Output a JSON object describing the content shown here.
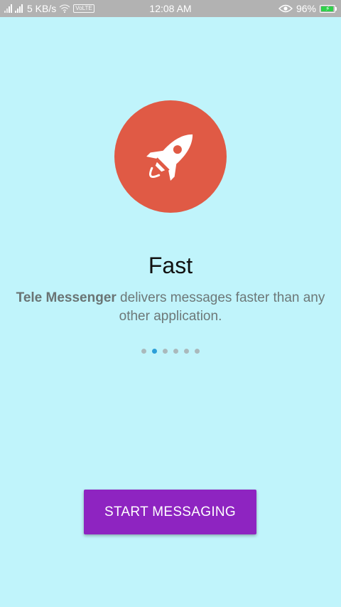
{
  "status_bar": {
    "net_speed": "5 KB/s",
    "volte_label": "VoLTE",
    "time": "12:08 AM",
    "battery_percent": "96%",
    "battery_level": 0.96,
    "battery_color": "#2ed14a"
  },
  "intro": {
    "icon": "rocket-icon",
    "icon_bg_color": "#e05a45",
    "title": "Fast",
    "description_bold": "Tele Messenger",
    "description_rest": " delivers messages faster than any other application.",
    "page_count": 6,
    "active_page": 2
  },
  "actions": {
    "start_label": "START MESSAGING",
    "start_color": "#8e24c1"
  },
  "colors": {
    "background": "#c0f4fb",
    "dot_active": "#2c9fd8",
    "dot_inactive": "#aab9bc"
  }
}
